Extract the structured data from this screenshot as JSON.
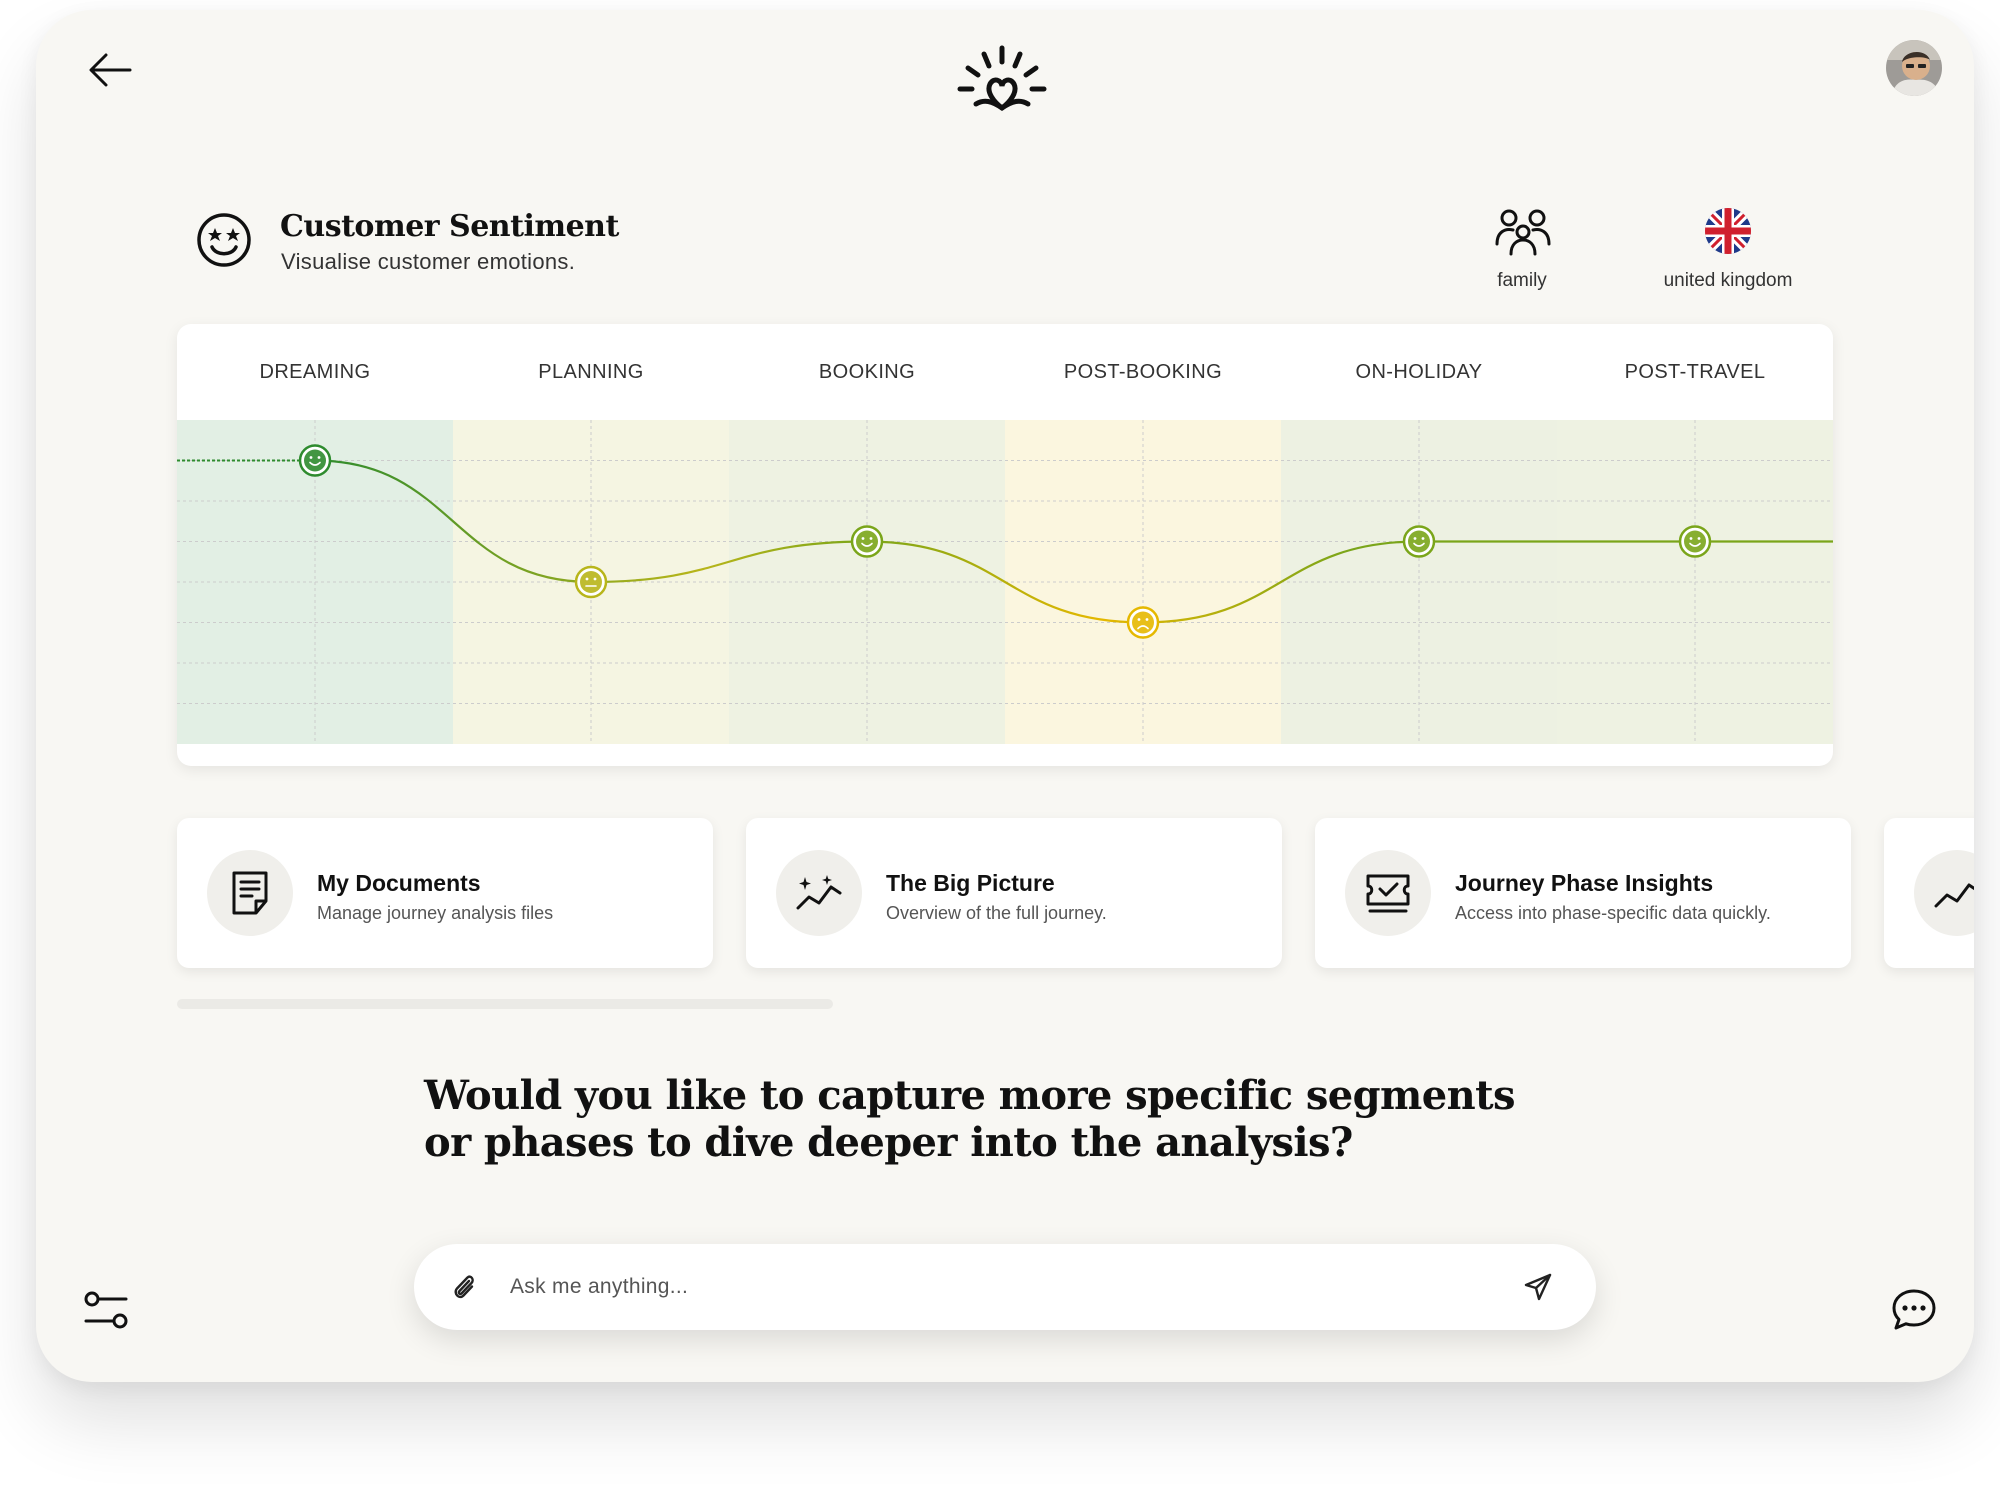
{
  "header": {
    "back_icon": "arrow-left-icon",
    "logo_icon": "sun-heart-logo",
    "avatar_icon": "user-avatar"
  },
  "section": {
    "icon": "star-eyes-smiley-icon",
    "title": "Customer Sentiment",
    "subtitle": "Visualise customer emotions."
  },
  "filters": [
    {
      "icon": "family-icon",
      "label": "family"
    },
    {
      "icon": "uk-flag-icon",
      "label": "united kingdom"
    }
  ],
  "phases": [
    "DREAMING",
    "PLANNING",
    "BOOKING",
    "POST-BOOKING",
    "ON-HOLIDAY",
    "POST-TRAVEL"
  ],
  "sentiment": {
    "scale_max": 8,
    "values": [
      7,
      4,
      5,
      3,
      5,
      5
    ],
    "moods": [
      "happy",
      "neutral",
      "happy",
      "sad",
      "happy",
      "happy"
    ],
    "colors": {
      "phase_bands": [
        "#e2efe4",
        "#f5f5e2",
        "#eef2e2",
        "#fbf6df",
        "#edf1e2",
        "#eef2e2"
      ],
      "happy_strong": "#2e8b2e",
      "happy": "#7aa51a",
      "neutral": "#b8b51a",
      "sad": "#e5b800",
      "grid": "#cccccc"
    }
  },
  "tiles": [
    {
      "icon": "document-icon",
      "title": "My Documents",
      "desc": "Manage journey analysis files"
    },
    {
      "icon": "sparkle-chart-icon",
      "title": "The Big Picture",
      "desc": "Overview of the full journey."
    },
    {
      "icon": "ticket-check-icon",
      "title": "Journey Phase Insights",
      "desc": "Access into phase-specific data quickly."
    },
    {
      "icon": "trend-icon",
      "title": "",
      "desc": ""
    }
  ],
  "prompt": {
    "question": "Would you like to capture more specific segments or phases to dive deeper into the analysis?"
  },
  "chat": {
    "placeholder": "Ask me anything...",
    "attach_icon": "paperclip-icon",
    "send_icon": "send-icon"
  },
  "footer": {
    "settings_icon": "sliders-icon",
    "chat_icon": "chat-bubble-icon"
  }
}
